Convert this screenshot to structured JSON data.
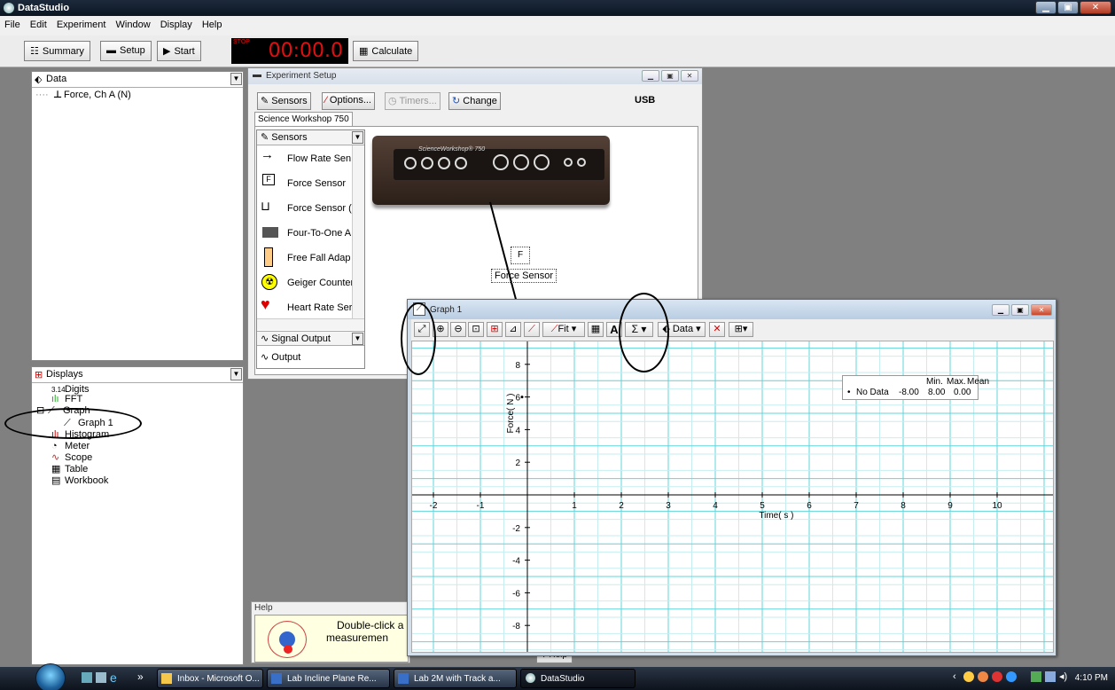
{
  "app": {
    "title": "DataStudio"
  },
  "menu": [
    "File",
    "Edit",
    "Experiment",
    "Window",
    "Display",
    "Help"
  ],
  "toolbar": {
    "summary": "Summary",
    "setup": "Setup",
    "start": "Start",
    "stop_label": "STOP",
    "timer": "00:00.0",
    "calculate": "Calculate"
  },
  "data_pane": {
    "header": "Data",
    "items": [
      "Force, Ch A (N)"
    ]
  },
  "displays_pane": {
    "header": "Displays",
    "items": [
      "Digits",
      "FFT",
      "Graph",
      "Graph 1",
      "Histogram",
      "Meter",
      "Scope",
      "Table",
      "Workbook"
    ]
  },
  "experiment_setup": {
    "title": "Experiment Setup",
    "buttons": {
      "sensors": "Sensors",
      "options": "Options...",
      "timers": "Timers...",
      "change": "Change"
    },
    "interface": "USB",
    "tab": "Science Workshop 750",
    "sensor_dropdown": "Sensors",
    "sensors": [
      "Flow Rate Sen",
      "Force Sensor",
      "Force Sensor (",
      "Four-To-One A",
      "Free Fall Adap",
      "Geiger Counter",
      "Heart Rate Ser"
    ],
    "signal_dropdown": "Signal Output",
    "output_item": "Output",
    "device_brand": "ScienceWorkshop® 750",
    "connected_sensor": "Force Sensor"
  },
  "graph": {
    "title": "Graph 1",
    "toolbar": {
      "fit": "Fit",
      "data": "Data"
    },
    "stats": {
      "headers": [
        "Min.",
        "Max.",
        "Mean"
      ],
      "row_label": "No Data",
      "values": [
        "-8.00",
        "8.00",
        "0.00"
      ]
    },
    "xlabel": "Time( s )",
    "ylabel": "Force( N )"
  },
  "chart_data": {
    "type": "line",
    "series": [],
    "x_ticks": [
      -2,
      -1,
      1,
      2,
      3,
      4,
      5,
      6,
      7,
      8,
      9,
      10
    ],
    "y_ticks": [
      8,
      6,
      4,
      2,
      -2,
      -4,
      -6,
      -8
    ],
    "xlim": [
      -2.5,
      10.5
    ],
    "ylim": [
      -9,
      9
    ],
    "xlabel": "Time( s )",
    "ylabel": "Force( N )",
    "grid": true
  },
  "help": {
    "header": "Help",
    "text_line1": "Double-click a",
    "text_line2": "measuremen",
    "button": "Help"
  },
  "taskbar": {
    "tasks": [
      "Inbox - Microsoft O...",
      "Lab Incline Plane Re...",
      "Lab 2M with Track a...",
      "DataStudio"
    ],
    "clock": "4:10 PM"
  }
}
